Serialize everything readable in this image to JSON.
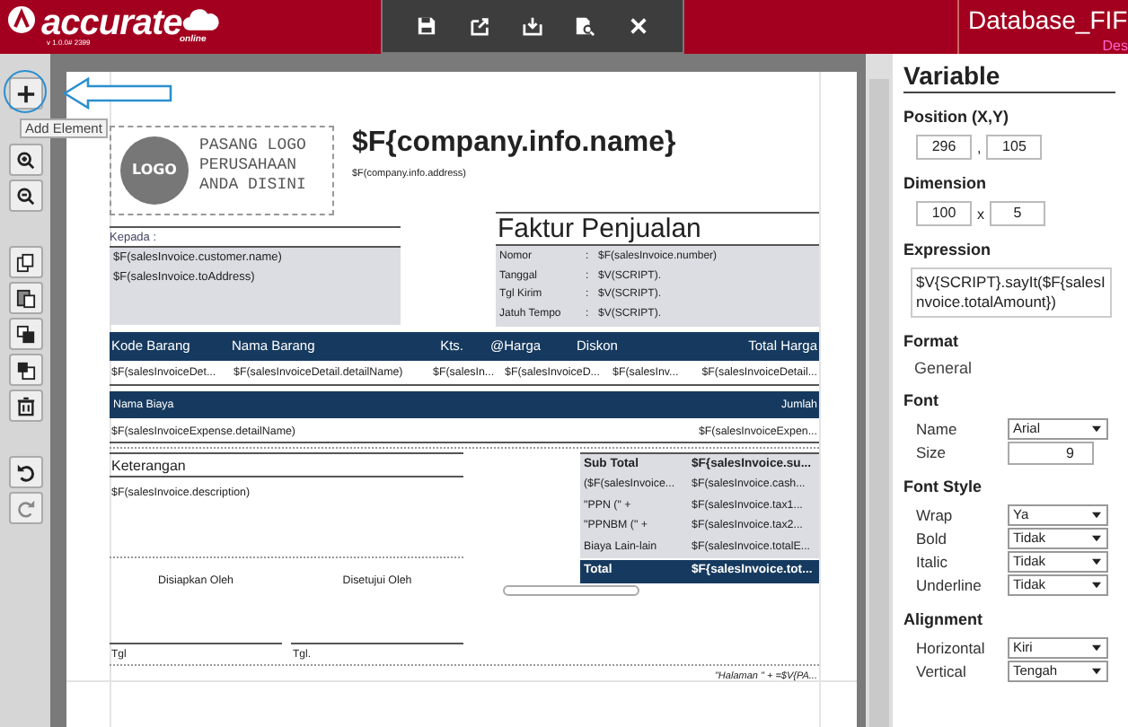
{
  "app": {
    "logo_text": "accurate",
    "logo_sub": "online",
    "version": "v 1.0.0# 2399",
    "database": "Database_FIF",
    "user": "Des"
  },
  "top_toolbar": [
    {
      "kind": "save"
    },
    {
      "kind": "export"
    },
    {
      "kind": "import"
    },
    {
      "kind": "preview"
    },
    {
      "kind": "close"
    }
  ],
  "side_tools": [
    {
      "kind": "add",
      "highlighted": true,
      "tooltip": "Add Element"
    },
    {
      "kind": "zoom-in",
      "highlighted": false
    },
    {
      "kind": "zoom-out",
      "highlighted": false
    },
    {
      "kind": "copy",
      "highlighted": false
    },
    {
      "kind": "paste",
      "highlighted": false
    },
    {
      "kind": "front",
      "highlighted": false
    },
    {
      "kind": "back",
      "highlighted": false
    },
    {
      "kind": "delete",
      "highlighted": false
    },
    {
      "kind": "undo",
      "highlighted": false
    },
    {
      "kind": "redo",
      "highlighted": false
    }
  ],
  "report": {
    "logo_badge": "LOGO",
    "logo_lines": [
      "PASANG LOGO",
      "PERUSAHAAN",
      "ANDA DISINI"
    ],
    "company_name": "$F{company.info.name}",
    "company_address": "$F(company.info.address)",
    "to_label": "Kepada :",
    "to_lines": [
      "$F(salesInvoice.customer.name)",
      "$F(salesInvoice.toAddress)"
    ],
    "title": "Faktur Penjualan",
    "info": [
      {
        "label": "Nomor",
        "colon": ":",
        "value": "$F(salesInvoice.number)"
      },
      {
        "label": "Tanggal",
        "colon": ":",
        "value": "$V(SCRIPT)."
      },
      {
        "label": "Tgl Kirim",
        "colon": ":",
        "value": "$V(SCRIPT)."
      },
      {
        "label": "Jatuh Tempo",
        "colon": ":",
        "value": "$V(SCRIPT)."
      }
    ],
    "item_columns": [
      "Kode Barang",
      "Nama Barang",
      "Kts.",
      "@Harga",
      "Diskon",
      "Total Harga"
    ],
    "item_cells": [
      "$F(salesInvoiceDet...",
      "$F(salesInvoiceDetail.detailName)",
      "$F(salesIn...",
      "$F(salesInvoiceD...",
      "$F(salesInv...",
      "$F(salesInvoiceDetail..."
    ],
    "expense_columns": [
      "Nama Biaya",
      "Jumlah"
    ],
    "expense_cells": [
      "$F(salesInvoiceExpense.detailName)",
      "$F(salesInvoiceExpen..."
    ],
    "notes_label": "Keterangan",
    "notes_value": "$F(salesInvoice.description)",
    "summary": [
      {
        "kind": "subtotal",
        "label": "Sub Total",
        "value": "$F{salesInvoice.su..."
      },
      {
        "kind": "line",
        "label": "($F(salesInvoice...",
        "value": "$F(salesInvoice.cash..."
      },
      {
        "kind": "line",
        "label": "\"PPN (\" +",
        "value": "$F(salesInvoice.tax1..."
      },
      {
        "kind": "line",
        "label": "\"PPNBM (\" +",
        "value": "$F(salesInvoice.tax2..."
      },
      {
        "kind": "line",
        "label": "Biaya Lain-lain",
        "value": "$F(salesInvoice.totalE..."
      },
      {
        "kind": "total",
        "label": "Total",
        "value": "$F{salesInvoice.tot..."
      }
    ],
    "signatures": [
      {
        "title": "Disiapkan Oleh",
        "date_label": "Tgl"
      },
      {
        "title": "Disetujui Oleh",
        "date_label": "Tgl."
      }
    ],
    "page_footer": "\"Halaman \" + =$V{PA..."
  },
  "properties": {
    "title": "Variable",
    "sections": [
      {
        "kind": "pair",
        "heading": "Position (X,Y)",
        "values": [
          "296",
          "105"
        ],
        "separator": ","
      },
      {
        "kind": "pair",
        "heading": "Dimension",
        "values": [
          "100",
          "5"
        ],
        "separator": "x"
      },
      {
        "kind": "text",
        "heading": "Expression",
        "value": "$V{SCRIPT}.sayIt($F{salesInvoice.totalAmount})"
      },
      {
        "kind": "plain",
        "heading": "Format",
        "value": "General"
      },
      {
        "kind": "rows",
        "heading": "Font",
        "rows": [
          {
            "label": "Name",
            "kind": "select",
            "value": "Arial"
          },
          {
            "label": "Size",
            "kind": "input",
            "value": "9"
          }
        ]
      },
      {
        "kind": "rows",
        "heading": "Font Style",
        "rows": [
          {
            "label": "Wrap",
            "kind": "select",
            "value": "Ya"
          },
          {
            "label": "Bold",
            "kind": "select",
            "value": "Tidak"
          },
          {
            "label": "Italic",
            "kind": "select",
            "value": "Tidak"
          },
          {
            "label": "Underline",
            "kind": "select",
            "value": "Tidak"
          }
        ]
      },
      {
        "kind": "rows",
        "heading": "Alignment",
        "rows": [
          {
            "label": "Horizontal",
            "kind": "select",
            "value": "Kiri"
          },
          {
            "label": "Vertical",
            "kind": "select",
            "value": "Tengah"
          }
        ]
      }
    ]
  }
}
